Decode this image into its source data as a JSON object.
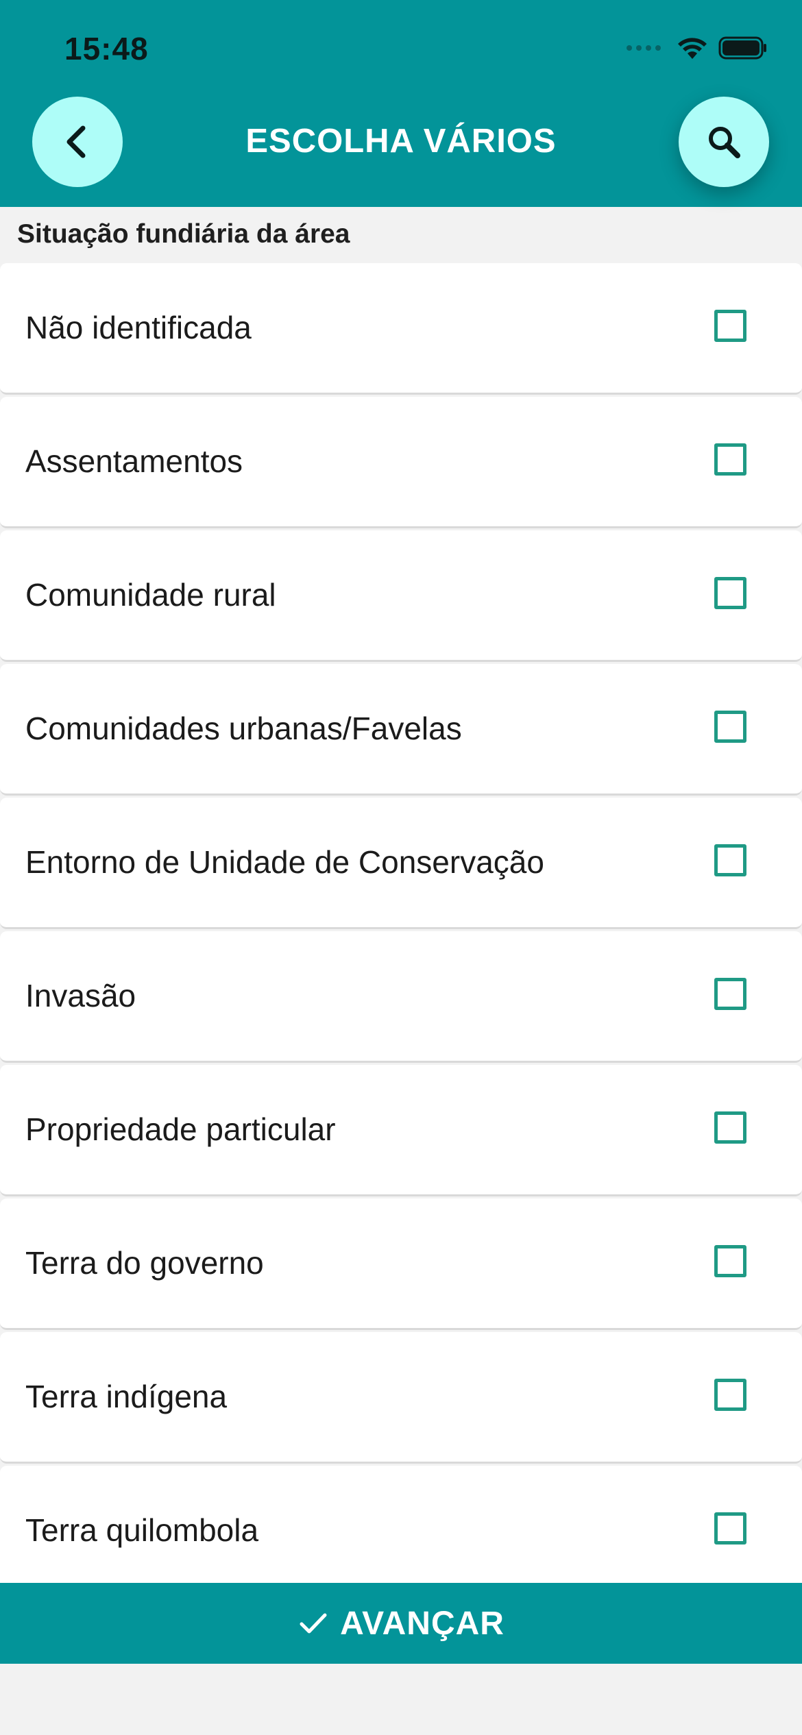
{
  "status_bar": {
    "time": "15:48"
  },
  "header": {
    "title": "ESCOLHA VÁRIOS",
    "back_icon": "chevron-left-icon",
    "search_icon": "search-icon",
    "background_color": "#039499",
    "button_color": "#aefdf8"
  },
  "section": {
    "label": "Situação fundiária da área"
  },
  "options": [
    {
      "label": "Não identificada",
      "checked": false
    },
    {
      "label": "Assentamentos",
      "checked": false
    },
    {
      "label": "Comunidade rural",
      "checked": false
    },
    {
      "label": "Comunidades urbanas/Favelas",
      "checked": false
    },
    {
      "label": "Entorno de Unidade de Conservação",
      "checked": false
    },
    {
      "label": "Invasão",
      "checked": false
    },
    {
      "label": "Propriedade particular",
      "checked": false
    },
    {
      "label": "Terra do governo",
      "checked": false
    },
    {
      "label": "Terra indígena",
      "checked": false
    },
    {
      "label": "Terra quilombola",
      "checked": false
    }
  ],
  "footer": {
    "advance_label": "AVANÇAR",
    "advance_icon": "check-icon"
  },
  "colors": {
    "checkbox_border": "#1f9a85"
  }
}
